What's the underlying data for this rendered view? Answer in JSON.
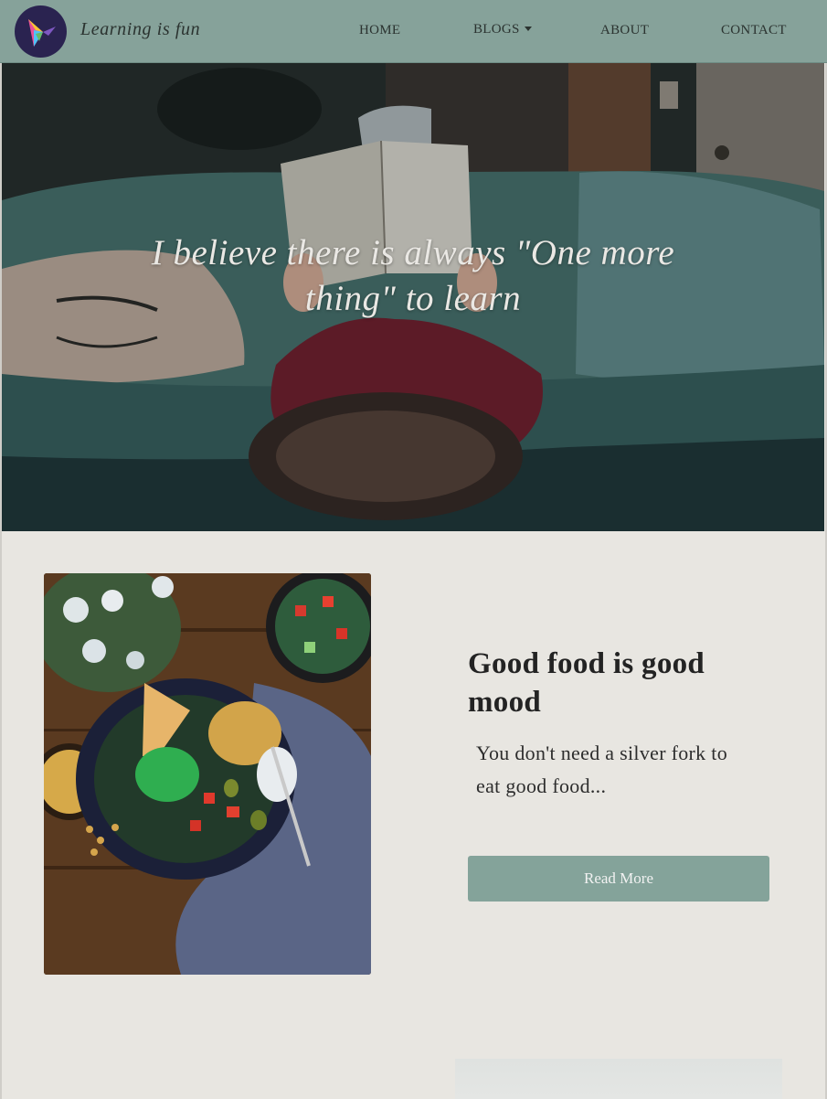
{
  "navbar": {
    "brand": "Learning is fun",
    "logo_icon": "hummingbird-logo-icon",
    "links": [
      {
        "label": "HOME"
      },
      {
        "label": "BLOGS"
      },
      {
        "label": "ABOUT"
      },
      {
        "label": "CONTACT"
      }
    ],
    "blogs_dropdown_icon": "caret-down-icon"
  },
  "hero": {
    "quote_line1": "I believe there is always \"One more",
    "quote_line2": "thing\" to learn",
    "image": "woman-reading-on-sofa-photo"
  },
  "post": {
    "image": "food-bowl-photo",
    "title": "Good food is good mood",
    "excerpt": "You don't need a silver fork to eat good food...",
    "button_label": "Read More"
  },
  "colors": {
    "navbar_bg": "#86a29a",
    "page_bg": "#e8e6e1",
    "button_bg": "#84a39a"
  }
}
